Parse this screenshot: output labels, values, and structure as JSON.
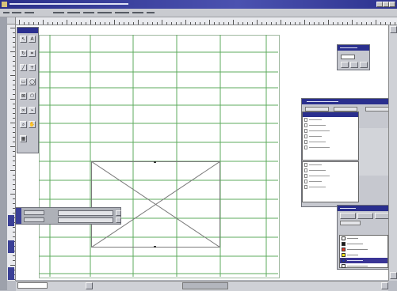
{
  "app": {
    "title": "",
    "colors": {
      "title_bar": "#2a2f8e",
      "guide": "#5cab5c",
      "canvas": "#ffffff",
      "chrome": "#c6c8cf",
      "selection": "#3a3596"
    }
  },
  "menubar": {
    "items": [
      {
        "label": "",
        "icon": "menu"
      },
      {
        "label": "",
        "icon": "menu"
      },
      {
        "label": "",
        "icon": "menu"
      },
      {
        "label": "",
        "icon": "menu"
      },
      {
        "label": "",
        "icon": "menu"
      },
      {
        "label": "",
        "icon": "menu"
      },
      {
        "label": "",
        "icon": "menu"
      },
      {
        "label": "",
        "icon": "menu"
      },
      {
        "label": "",
        "icon": "menu"
      },
      {
        "label": "",
        "icon": "menu"
      }
    ]
  },
  "toolbox": {
    "tools": [
      {
        "icon": "arrow-pointer-icon",
        "glyph": "↖"
      },
      {
        "icon": "text-tool-icon",
        "glyph": "A"
      },
      {
        "icon": "rotate-tool-icon",
        "glyph": "↻"
      },
      {
        "icon": "crop-tool-icon",
        "glyph": "⌗"
      },
      {
        "icon": "line-tool-icon",
        "glyph": "╱"
      },
      {
        "icon": "orthogonal-line-icon",
        "glyph": "+"
      },
      {
        "icon": "box-tool-icon",
        "glyph": "▭"
      },
      {
        "icon": "oval-tool-icon",
        "glyph": "◯"
      },
      {
        "icon": "picture-box-icon",
        "glyph": "⊠"
      },
      {
        "icon": "polygon-tool-icon",
        "glyph": "⬠"
      },
      {
        "icon": "link-tool-icon",
        "glyph": "∞"
      },
      {
        "icon": "unlink-tool-icon",
        "glyph": "⌁"
      },
      {
        "icon": "zoom-tool-icon",
        "glyph": "⌕"
      },
      {
        "icon": "hand-tool-icon",
        "glyph": "✋"
      },
      {
        "icon": "table-tool-icon",
        "glyph": "▦"
      }
    ]
  },
  "measurements_palette": {
    "fields": [
      "",
      "",
      ""
    ]
  },
  "small_palette": {
    "title": "",
    "field": ""
  },
  "document_layout": {
    "title": "",
    "master_pages": [
      "",
      "",
      "",
      "",
      "",
      ""
    ],
    "document_pages": [
      "",
      "",
      "",
      "",
      ""
    ]
  },
  "colors_palette": {
    "title": "",
    "tabs": [
      "",
      "",
      ""
    ],
    "rows": [
      {
        "name": "",
        "color": "#ffffff"
      },
      {
        "name": "",
        "color": "#1a1a1a"
      },
      {
        "name": "",
        "color": "#e33a2b"
      },
      {
        "name": "",
        "color": "#f3e313"
      },
      {
        "name": "",
        "color": "#1f2fb5"
      },
      {
        "name": "",
        "color": "#ffffff"
      }
    ],
    "selected_index": 4
  },
  "page_indicator": {
    "value": ""
  }
}
